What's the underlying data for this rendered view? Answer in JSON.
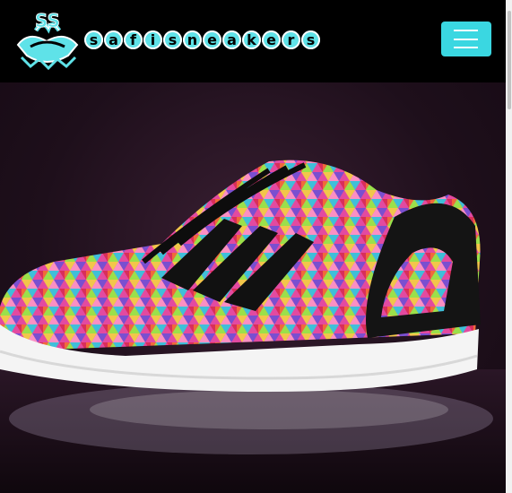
{
  "header": {
    "brand": "SafiSneakers",
    "brand_letters": [
      "s",
      "a",
      "f",
      "i",
      "s",
      "n",
      "e",
      "a",
      "k",
      "e",
      "r",
      "s"
    ],
    "logo_icon": "safisneakers-logo-icon",
    "menu_icon": "hamburger-icon",
    "colors": {
      "background": "#000000",
      "accent": "#3ad7e1"
    }
  },
  "hero": {
    "image": "multicolor-prism-sneaker",
    "colors": {
      "background": "#1e0f1b",
      "sole": "#f4f4f4",
      "stripes": "#111111"
    }
  }
}
